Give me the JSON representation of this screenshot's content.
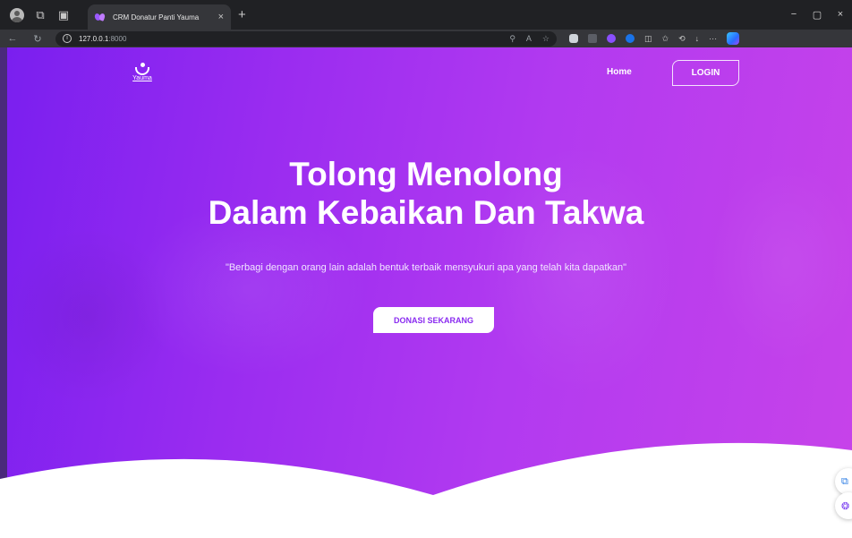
{
  "browser": {
    "tab_title": "CRM Donatur Panti Yauma",
    "tab_close": "×",
    "new_tab": "+",
    "url_host": "127.0.0.1",
    "url_port": ":8000",
    "window_controls": [
      "−",
      "▢",
      "×"
    ]
  },
  "site": {
    "logo_text": "Yauma",
    "nav": {
      "home": "Home",
      "login": "LOGIN"
    },
    "hero": {
      "headline_line1": "Tolong Menolong",
      "headline_line2": "Dalam Kebaikan Dan Takwa",
      "quote": "\"Berbagi dengan orang lain adalah bentuk terbaik mensyukuri apa yang telah kita dapatkan\"",
      "cta_label": "DONASI SEKARANG"
    },
    "colors": {
      "gradient_start": "#7a1fef",
      "gradient_end": "#c743e9",
      "cta_text": "#8a2bf0"
    }
  }
}
